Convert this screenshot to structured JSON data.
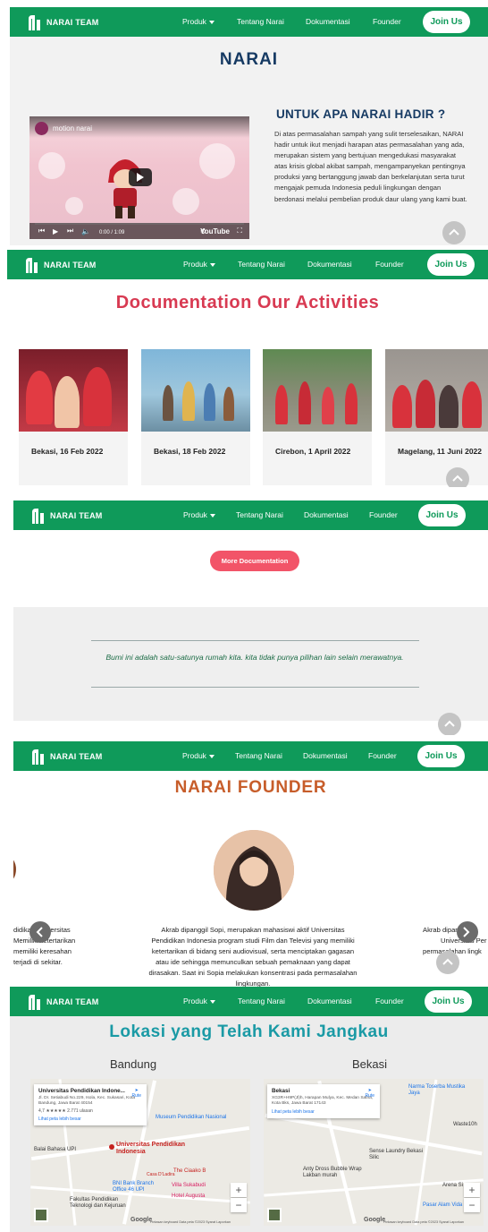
{
  "nav": {
    "brand": "NARAI TEAM",
    "links": [
      "Produk",
      "Tentang Narai",
      "Dokumentasi",
      "Founder"
    ],
    "join": "Join Us"
  },
  "about": {
    "title": "NARAI",
    "video_title": "motion narai",
    "video_time": "0:00 / 1:09",
    "video_brand": "YouTube",
    "heading": "UNTUK APA NARAI HADIR ?",
    "body": "Di atas permasalahan sampah yang sulit terselesaikan, NARAI hadir untuk ikut menjadi harapan atas permasalahan yang ada, merupakan sistem yang bertujuan mengedukasi masyarakat atas krisis global akibat sampah, mengampanyekan pentingnya produksi yang bertanggung jawab dan berkelanjutan serta turut mengajak pemuda Indonesia peduli lingkungan dengan berdonasi melalui pembelian produk daur ulang yang kami buat."
  },
  "documentation": {
    "title": "Documentation Our Activities",
    "cards": [
      {
        "caption": "Bekasi, 16 Feb 2022"
      },
      {
        "caption": "Bekasi, 18 Feb 2022"
      },
      {
        "caption": "Cirebon, 1 April 2022"
      },
      {
        "caption": "Magelang, 11 Juni 2022"
      }
    ],
    "more_button": "More Documentation",
    "quote": "Bumi ini adalah satu-satunya rumah kita. kita tidak punya pilihan lain selain merawatnya."
  },
  "founder": {
    "title": "NARAI FOUNDER",
    "bio": "Akrab dipanggil Sopi, merupakan mahasiswi aktif Universitas Pendidikan Indonesia program studi Film dan Televisi yang memiliki ketertarikan di bidang seni audiovisual, serta menciptakan gagasan atau ide sehingga memunculkan sebuah pemaknaan yang dapat dirasakan. Saat ini Sopia melakukan konsentrasi pada permasalahan lingkungan.",
    "left_bio_lines": [
      "didikan Universitas",
      "Memiliki ketertarikan",
      "memiliki keresahan",
      "terjadi di sekitar."
    ],
    "right_bio_lines": [
      "Akrab dipanggil I",
      "Universitas Per",
      "permasalahan lingk"
    ]
  },
  "locations": {
    "title": "Lokasi yang Telah Kami Jangkau",
    "cities": [
      {
        "name": "Bandung",
        "place": "Universitas Pendidikan Indone...",
        "address": "Jl. Dr. Setiabudi No.229, Isola, Kec. Sukasari, Kota Bandung, Jawa Barat 40154",
        "rating": "4,7 ★★★★★ 2.771 ulasan",
        "link": "Lihat peta lebih besar",
        "route": "Rute",
        "pois": [
          "Universitas Pendidikan Indonesia",
          "Balai Bahasa UPI",
          "Museum Pendidikan Nasional",
          "BNI Bank Branch Office 46 UPI",
          "Villa Sukabudi",
          "Hotel Augusta",
          "Fakultas Pendidikan Teknologi dan Kejuruan",
          "Casa D'Ladira",
          "The Ciaako B"
        ]
      },
      {
        "name": "Bekasi",
        "place": "Bekasi",
        "address": "XG3R+H9P(Jl)h, Harapan Mulya, Kec. Medan Satria, Kota Bks, Jawa Barat 17143",
        "link": "Lihat peta lebih besar",
        "route": "Rute",
        "pois": [
          "Narma Toserba Mustika Jaya",
          "Sense Laundry Bekasi Silic",
          "Anty Dross Bubble Wrap Lakban murah",
          "Waste10h",
          "Arena Si",
          "Pasar Alam Vida"
        ]
      }
    ],
    "map_brand": "Google",
    "map_footer": "Pintasan keyboard   Data peta ©2023   Syarat   Laporkan"
  },
  "colors": {
    "nav_green": "#0f9a5a",
    "navy": "#163a63",
    "doc_red": "#d83a52",
    "founder_orange": "#c75d2a",
    "location_teal": "#1a9aa5",
    "button_pink": "#f25468"
  }
}
